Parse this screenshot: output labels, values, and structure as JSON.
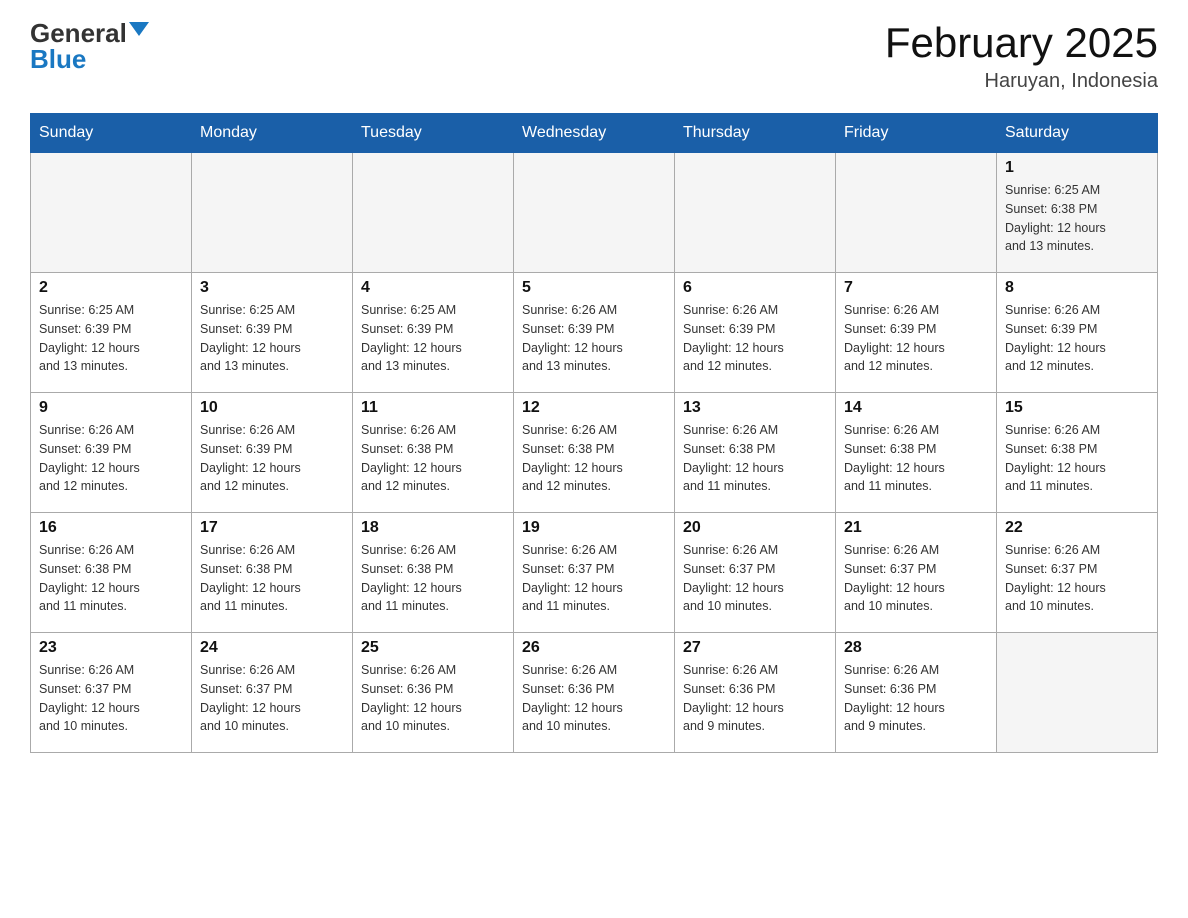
{
  "header": {
    "logo_general": "General",
    "logo_blue": "Blue",
    "title": "February 2025",
    "subtitle": "Haruyan, Indonesia"
  },
  "days_of_week": [
    "Sunday",
    "Monday",
    "Tuesday",
    "Wednesday",
    "Thursday",
    "Friday",
    "Saturday"
  ],
  "weeks": [
    [
      {
        "day": "",
        "info": ""
      },
      {
        "day": "",
        "info": ""
      },
      {
        "day": "",
        "info": ""
      },
      {
        "day": "",
        "info": ""
      },
      {
        "day": "",
        "info": ""
      },
      {
        "day": "",
        "info": ""
      },
      {
        "day": "1",
        "info": "Sunrise: 6:25 AM\nSunset: 6:38 PM\nDaylight: 12 hours\nand 13 minutes."
      }
    ],
    [
      {
        "day": "2",
        "info": "Sunrise: 6:25 AM\nSunset: 6:39 PM\nDaylight: 12 hours\nand 13 minutes."
      },
      {
        "day": "3",
        "info": "Sunrise: 6:25 AM\nSunset: 6:39 PM\nDaylight: 12 hours\nand 13 minutes."
      },
      {
        "day": "4",
        "info": "Sunrise: 6:25 AM\nSunset: 6:39 PM\nDaylight: 12 hours\nand 13 minutes."
      },
      {
        "day": "5",
        "info": "Sunrise: 6:26 AM\nSunset: 6:39 PM\nDaylight: 12 hours\nand 13 minutes."
      },
      {
        "day": "6",
        "info": "Sunrise: 6:26 AM\nSunset: 6:39 PM\nDaylight: 12 hours\nand 12 minutes."
      },
      {
        "day": "7",
        "info": "Sunrise: 6:26 AM\nSunset: 6:39 PM\nDaylight: 12 hours\nand 12 minutes."
      },
      {
        "day": "8",
        "info": "Sunrise: 6:26 AM\nSunset: 6:39 PM\nDaylight: 12 hours\nand 12 minutes."
      }
    ],
    [
      {
        "day": "9",
        "info": "Sunrise: 6:26 AM\nSunset: 6:39 PM\nDaylight: 12 hours\nand 12 minutes."
      },
      {
        "day": "10",
        "info": "Sunrise: 6:26 AM\nSunset: 6:39 PM\nDaylight: 12 hours\nand 12 minutes."
      },
      {
        "day": "11",
        "info": "Sunrise: 6:26 AM\nSunset: 6:38 PM\nDaylight: 12 hours\nand 12 minutes."
      },
      {
        "day": "12",
        "info": "Sunrise: 6:26 AM\nSunset: 6:38 PM\nDaylight: 12 hours\nand 12 minutes."
      },
      {
        "day": "13",
        "info": "Sunrise: 6:26 AM\nSunset: 6:38 PM\nDaylight: 12 hours\nand 11 minutes."
      },
      {
        "day": "14",
        "info": "Sunrise: 6:26 AM\nSunset: 6:38 PM\nDaylight: 12 hours\nand 11 minutes."
      },
      {
        "day": "15",
        "info": "Sunrise: 6:26 AM\nSunset: 6:38 PM\nDaylight: 12 hours\nand 11 minutes."
      }
    ],
    [
      {
        "day": "16",
        "info": "Sunrise: 6:26 AM\nSunset: 6:38 PM\nDaylight: 12 hours\nand 11 minutes."
      },
      {
        "day": "17",
        "info": "Sunrise: 6:26 AM\nSunset: 6:38 PM\nDaylight: 12 hours\nand 11 minutes."
      },
      {
        "day": "18",
        "info": "Sunrise: 6:26 AM\nSunset: 6:38 PM\nDaylight: 12 hours\nand 11 minutes."
      },
      {
        "day": "19",
        "info": "Sunrise: 6:26 AM\nSunset: 6:37 PM\nDaylight: 12 hours\nand 11 minutes."
      },
      {
        "day": "20",
        "info": "Sunrise: 6:26 AM\nSunset: 6:37 PM\nDaylight: 12 hours\nand 10 minutes."
      },
      {
        "day": "21",
        "info": "Sunrise: 6:26 AM\nSunset: 6:37 PM\nDaylight: 12 hours\nand 10 minutes."
      },
      {
        "day": "22",
        "info": "Sunrise: 6:26 AM\nSunset: 6:37 PM\nDaylight: 12 hours\nand 10 minutes."
      }
    ],
    [
      {
        "day": "23",
        "info": "Sunrise: 6:26 AM\nSunset: 6:37 PM\nDaylight: 12 hours\nand 10 minutes."
      },
      {
        "day": "24",
        "info": "Sunrise: 6:26 AM\nSunset: 6:37 PM\nDaylight: 12 hours\nand 10 minutes."
      },
      {
        "day": "25",
        "info": "Sunrise: 6:26 AM\nSunset: 6:36 PM\nDaylight: 12 hours\nand 10 minutes."
      },
      {
        "day": "26",
        "info": "Sunrise: 6:26 AM\nSunset: 6:36 PM\nDaylight: 12 hours\nand 10 minutes."
      },
      {
        "day": "27",
        "info": "Sunrise: 6:26 AM\nSunset: 6:36 PM\nDaylight: 12 hours\nand 9 minutes."
      },
      {
        "day": "28",
        "info": "Sunrise: 6:26 AM\nSunset: 6:36 PM\nDaylight: 12 hours\nand 9 minutes."
      },
      {
        "day": "",
        "info": ""
      }
    ]
  ]
}
